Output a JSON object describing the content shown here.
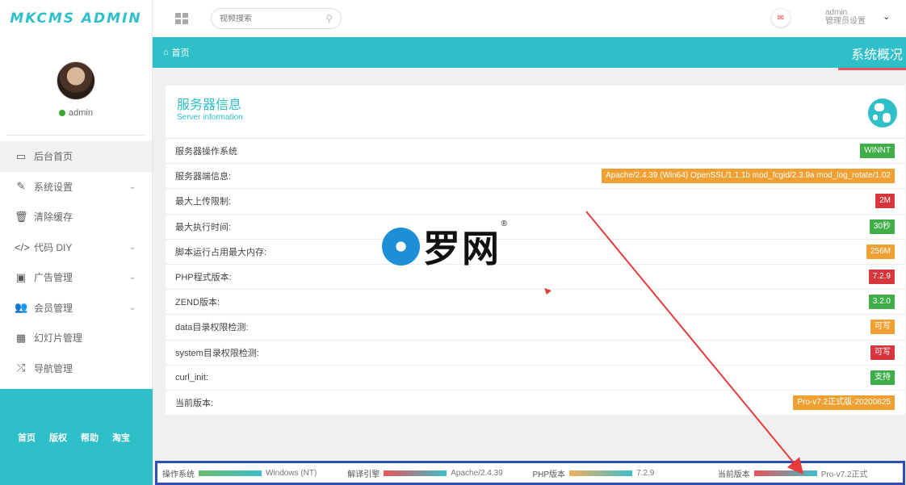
{
  "app": {
    "logo": "MKCMS ADMIN"
  },
  "sidebar": {
    "user": "admin",
    "items": [
      {
        "label": "后台首页",
        "icon": "laptop-icon",
        "glyph": "▭",
        "caret": ""
      },
      {
        "label": "系统设置",
        "icon": "wrench-icon",
        "glyph": "✎",
        "caret": "⌄"
      },
      {
        "label": "清除缓存",
        "icon": "trash-icon",
        "glyph": "🗑",
        "caret": ""
      },
      {
        "label": "代码 DIY",
        "icon": "code-icon",
        "glyph": "</>",
        "caret": "⌄"
      },
      {
        "label": "广告管理",
        "icon": "image-icon",
        "glyph": "▣",
        "caret": "⌄"
      },
      {
        "label": "会员管理",
        "icon": "users-icon",
        "glyph": "👥",
        "caret": "⌄"
      },
      {
        "label": "幻灯片管理",
        "icon": "table-icon",
        "glyph": "▦",
        "caret": ""
      },
      {
        "label": "导航管理",
        "icon": "shuffle-icon",
        "glyph": "⤮",
        "caret": ""
      }
    ],
    "footer_links": [
      "首页",
      "版权",
      "帮助",
      "淘宝"
    ]
  },
  "topbar": {
    "search_placeholder": "视频搜索",
    "user_name": "admin",
    "user_role": "管理员设置"
  },
  "breadcrumb": {
    "home": "首页",
    "page_title": "系统概况"
  },
  "panel": {
    "title": "服务器信息",
    "subtitle": "Server information",
    "rows": [
      {
        "label": "服务器操作系统",
        "value": "WINNT",
        "color": "#3fae49"
      },
      {
        "label": "服务器端信息:",
        "value": "Apache/2.4.39 (Win64) OpenSSL/1.1.1b mod_fcgid/2.3.9a mod_log_rotate/1.02",
        "color": "#f0a032"
      },
      {
        "label": "最大上传限制:",
        "value": "2M",
        "color": "#d6373c"
      },
      {
        "label": "最大执行时间:",
        "value": "30秒",
        "color": "#3fae49"
      },
      {
        "label": "脚本运行占用最大内存:",
        "value": "256M",
        "color": "#f0a032"
      },
      {
        "label": "PHP程式版本:",
        "value": "7.2.9",
        "color": "#d6373c"
      },
      {
        "label": "ZEND版本:",
        "value": "3.2.0",
        "color": "#3fae49"
      },
      {
        "label": "data目录权限检测:",
        "value": "可写",
        "color": "#f0a032"
      },
      {
        "label": "system目录权限检测:",
        "value": "可写",
        "color": "#d6373c"
      },
      {
        "label": "curl_init:",
        "value": "支持",
        "color": "#3fae49"
      },
      {
        "label": "当前版本:",
        "value": "Pro-v7.2正式版-20200625",
        "color": "#f0a032"
      }
    ]
  },
  "watermark": {
    "text": "罗网",
    "mark": "®"
  },
  "statusbar": [
    {
      "label": "操作系统",
      "value": "Windows (NT)",
      "bar": "linear-gradient(90deg,#6dbb6f,#3cbfc9)"
    },
    {
      "label": "解译引擎",
      "value": "Apache/2.4.39",
      "bar": "linear-gradient(90deg,#e8545a,#3cbfc9)"
    },
    {
      "label": "PHP版本",
      "value": "7.2.9",
      "bar": "linear-gradient(90deg,#f0b060,#3cbfc9)"
    },
    {
      "label": "当前版本",
      "value": "Pro-v7.2正式",
      "bar": "linear-gradient(90deg,#e8545a,#3cbfc9)"
    }
  ],
  "colors": {
    "accent": "#2fbfc9",
    "annotation_arrow": "#e53b3b",
    "statusbar_border": "#2f4fb4"
  }
}
